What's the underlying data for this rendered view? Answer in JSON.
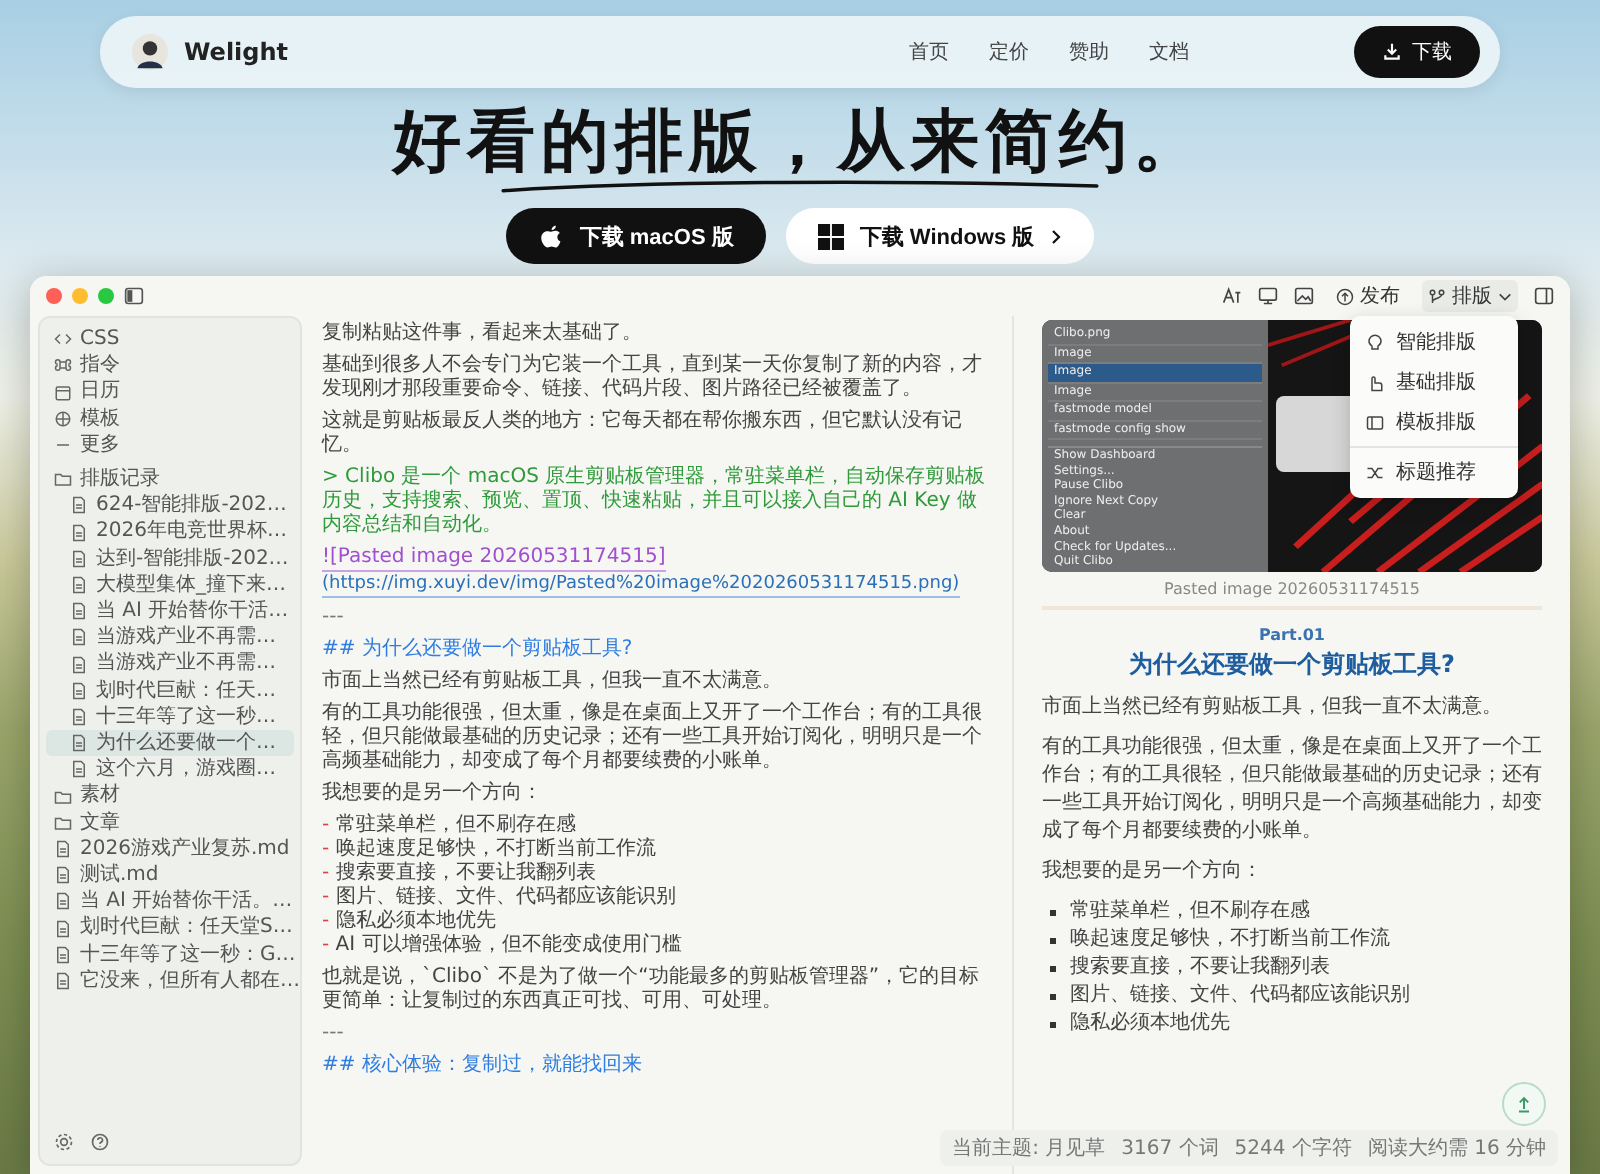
{
  "nav": {
    "brand": "Welight",
    "links": [
      "首页",
      "定价",
      "赞助",
      "文档"
    ],
    "download": "下载"
  },
  "hero": {
    "headline": "好看的排版，从来简约。",
    "buttons": [
      {
        "kind": "mac",
        "label": "下载 macOS 版"
      },
      {
        "kind": "windows",
        "label": "下载 Windows 版"
      }
    ]
  },
  "app": {
    "toolbar": {
      "publish": "发布",
      "format": "排版"
    },
    "format_menu": [
      {
        "kind": "smart",
        "label": "智能排版"
      },
      {
        "kind": "basic",
        "label": "基础排版"
      },
      {
        "kind": "template",
        "label": "模板排版"
      },
      {
        "kind": "title",
        "label": "标题推荐"
      }
    ],
    "sidebar": {
      "tools": [
        {
          "kind": "code",
          "label": "CSS"
        },
        {
          "kind": "command",
          "label": "指令"
        },
        {
          "kind": "calendar",
          "label": "日历"
        },
        {
          "kind": "template",
          "label": "模板"
        },
        {
          "kind": "more",
          "label": "更多"
        }
      ],
      "tree": [
        {
          "kind": "folder",
          "label": "排版记录",
          "selected": false,
          "children": [
            {
              "label": "624-智能排版-202…",
              "selected": false
            },
            {
              "label": "2026年电竞世界杯…",
              "selected": false
            },
            {
              "label": "达到-智能排版-202…",
              "selected": false
            },
            {
              "label": "大模型集体_撞下来…",
              "selected": false
            },
            {
              "label": "当 AI 开始替你干活…",
              "selected": false
            },
            {
              "label": "当游戏产业不再需…",
              "selected": false
            },
            {
              "label": "当游戏产业不再需…",
              "selected": false
            },
            {
              "label": "划时代巨献：任天…",
              "selected": false
            },
            {
              "label": "十三年等了这一秒…",
              "selected": false
            },
            {
              "label": "为什么还要做一个…",
              "selected": true
            },
            {
              "label": "这个六月，游戏圈…",
              "selected": false
            }
          ]
        },
        {
          "kind": "folder",
          "label": "素材",
          "selected": false
        },
        {
          "kind": "folder",
          "label": "文章",
          "selected": false
        },
        {
          "kind": "file",
          "label": "2026游戏产业复苏.md",
          "selected": false
        },
        {
          "kind": "file",
          "label": "测试.md",
          "selected": false
        },
        {
          "kind": "file",
          "label": "当 AI 开始替你干活。…",
          "selected": false
        },
        {
          "kind": "file",
          "label": "划时代巨献：任天堂S…",
          "selected": false
        },
        {
          "kind": "file",
          "label": "十三年等了这一秒：G…",
          "selected": false
        },
        {
          "kind": "file",
          "label": "它没来，但所有人都在…",
          "selected": false
        }
      ]
    },
    "editor": {
      "blocks": [
        {
          "kind": "para",
          "text": "复制粘贴这件事，看起来太基础了。"
        },
        {
          "kind": "para",
          "text": "基础到很多人不会专门为它装一个工具，直到某一天你复制了新的内容，才发现刚才那段重要命令、链接、代码片段、图片路径已经被覆盖了。"
        },
        {
          "kind": "para",
          "text": "这就是剪贴板最反人类的地方：它每天都在帮你搬东西，但它默认没有记忆。"
        },
        {
          "kind": "quote",
          "text": "> Clibo 是一个 macOS 原生剪贴板管理器，常驻菜单栏，自动保存剪贴板历史，支持搜索、预览、置顶、快速粘贴，并且可以接入自己的 AI Key 做内容总结和自动化。"
        },
        {
          "kind": "link",
          "alt": "![Pasted image 20260531174515]",
          "url": "(https://img.xuyi.dev/img/Pasted%20image%2020260531174515.png)"
        },
        {
          "kind": "rule",
          "text": "---"
        },
        {
          "kind": "heading",
          "text": "## 为什么还要做一个剪贴板工具?"
        },
        {
          "kind": "para",
          "text": "市面上当然已经有剪贴板工具，但我一直不太满意。"
        },
        {
          "kind": "para",
          "text": "有的工具功能很强，但太重，像是在桌面上又开了一个工作台；有的工具很轻，但只能做最基础的历史记录；还有一些工具开始订阅化，明明只是一个高频基础能力，却变成了每个月都要续费的小账单。"
        },
        {
          "kind": "para",
          "text": "我想要的是另一个方向："
        },
        {
          "kind": "list",
          "items": [
            {
              "marker": "-",
              "text": "常驻菜单栏，但不刷存在感"
            },
            {
              "marker": "-",
              "text": "唤起速度足够快，不打断当前工作流"
            },
            {
              "marker": "-",
              "text": "搜索要直接，不要让我翻列表"
            },
            {
              "marker": "-",
              "text": "图片、链接、文件、代码都应该能识别"
            },
            {
              "marker": "-",
              "text": "隐私必须本地优先"
            },
            {
              "marker": "-",
              "text": "AI 可以增强体验，但不能变成使用门槛"
            }
          ]
        },
        {
          "kind": "para",
          "text": "也就是说，`Clibo` 不是为了做一个“功能最多的剪贴板管理器”，它的目标更简单：让复制过的东西真正可找、可用、可处理。"
        },
        {
          "kind": "rule",
          "text": "---"
        },
        {
          "kind": "heading",
          "text": "## 核心体验：复制过，就能找回来"
        }
      ]
    }
  },
  "preview": {
    "screenshot": {
      "rows": [
        {
          "label": "Clibo.png",
          "selected": false
        },
        {
          "label": "Image",
          "selected": false
        },
        {
          "label": "Image",
          "selected": true
        },
        {
          "label": "Image",
          "selected": false
        },
        {
          "label": "fastmode model",
          "selected": false
        },
        {
          "label": "fastmode config show",
          "selected": false
        }
      ],
      "menu": [
        "Show Dashboard",
        "Settings...",
        "Pause Clibo",
        "Ignore Next Copy",
        "Clear",
        "About",
        "Check for Updates...",
        "Quit Clibo"
      ]
    },
    "caption": "Pasted image 20260531174515",
    "part": "Part.01",
    "heading": "为什么还要做一个剪贴板工具?",
    "paragraphs": [
      "市面上当然已经有剪贴板工具，但我一直不太满意。",
      "有的工具功能很强，但太重，像是在桌面上又开了一个工作台；有的工具很轻，但只能做最基础的历史记录；还有一些工具开始订阅化，明明只是一个高频基础能力，却变成了每个月都要续费的小账单。",
      "我想要的是另一个方向："
    ],
    "list": [
      "常驻菜单栏，但不刷存在感",
      "唤起速度足够快，不打断当前工作流",
      "搜索要直接，不要让我翻列表",
      "图片、链接、文件、代码都应该能识别",
      "隐私必须本地优先"
    ]
  },
  "status": {
    "theme": "当前主题: 月见草",
    "words": "3167 个词",
    "chars": "5244 个字符",
    "reading": "阅读大约需 16 分钟"
  }
}
